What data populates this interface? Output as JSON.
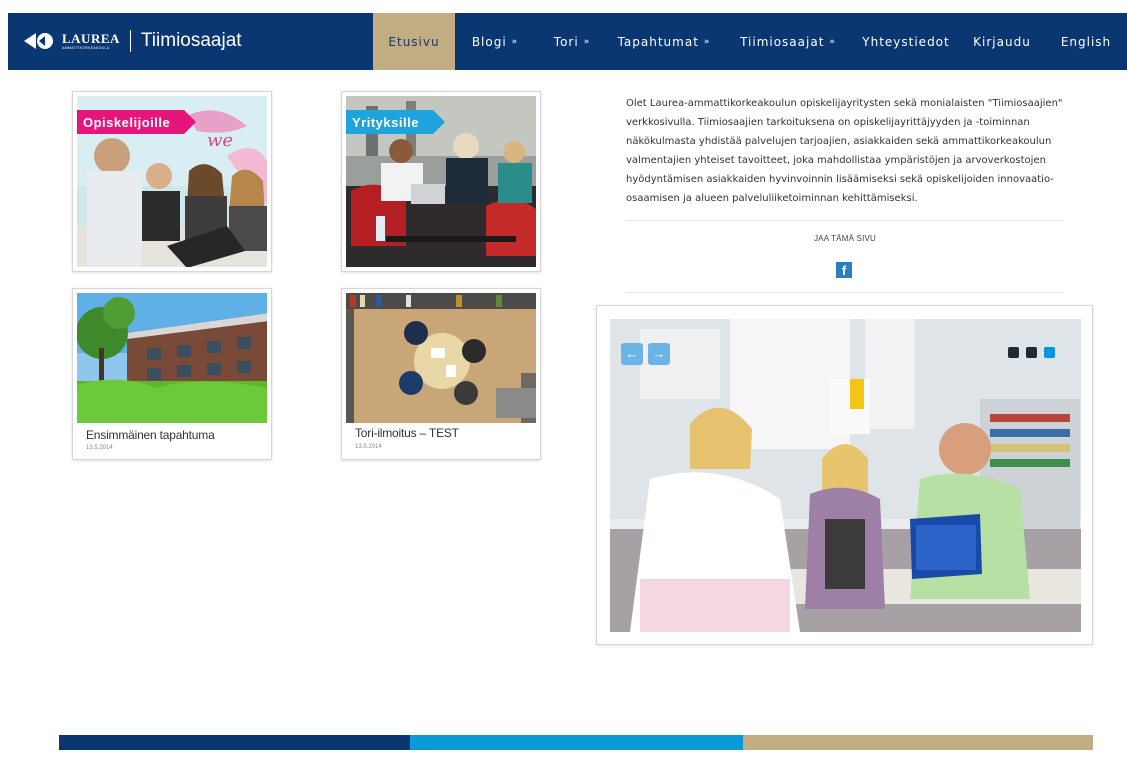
{
  "header": {
    "logo_text": "LAUREA",
    "logo_subtext": "AMMATTIKORKEAKOULU",
    "site_name": "Tiimiosaajat",
    "brand_color": "#0a3772",
    "active_color": "#c2ad82"
  },
  "nav": {
    "items": [
      {
        "label": "Etusivu",
        "dropdown": false,
        "active": true
      },
      {
        "label": "Blogi",
        "dropdown": true,
        "active": false
      },
      {
        "label": "Tori",
        "dropdown": true,
        "active": false
      },
      {
        "label": "Tapahtumat",
        "dropdown": true,
        "active": false
      },
      {
        "label": "Tiimiosaajat",
        "dropdown": true,
        "active": false
      },
      {
        "label": "Yhteystiedot",
        "dropdown": false,
        "active": false
      },
      {
        "label": "Kirjaudu",
        "dropdown": false,
        "active": false
      },
      {
        "label": "English",
        "dropdown": false,
        "active": false
      }
    ],
    "dropdown_glyph": "»"
  },
  "tiles": {
    "students": {
      "ribbon": "Opiskelijoille",
      "ribbon_color": "#e5167b"
    },
    "companies": {
      "ribbon": "Yrityksille",
      "ribbon_color": "#1ea3dc"
    }
  },
  "posts": [
    {
      "title": "Ensimmäinen tapahtuma",
      "date": "13.5.2014"
    },
    {
      "title": "Tori-ilmoitus – TEST",
      "date": "13.5.2014"
    }
  ],
  "intro": {
    "text": "Olet Laurea-ammattikorkeakoulun opiskelijayritysten sekä monialaisten \"Tiimiosaajien\" verkkosivulla. Tiimiosaajien tarkoituksena on opiskelijayrittäjyyden ja -toiminnan näkökulmasta yhdistää palvelujen tarjoajien, asiakkaiden sekä ammattikorkeakoulun valmentajien yhteiset tavoitteet, joka mahdollistaa ympäristöjen ja arvoverkostojen hyödyntämisen asiakkaiden hyvinvoinnin lisäämiseksi sekä opiskelijoiden innovaatio-osaamisen ja alueen palveluliiketoiminnan kehittämiseksi."
  },
  "share": {
    "label": "JAA TÄMÄ SIVU",
    "facebook_glyph": "f",
    "facebook_color": "#2a7fc0"
  },
  "slider": {
    "prev_glyph": "←",
    "next_glyph": "→",
    "slide_count": 3,
    "active_index": 2,
    "active_color": "#0096e0"
  },
  "footer": {
    "colors": [
      "#0a3772",
      "#0b9ad8",
      "#c2ad82"
    ]
  }
}
